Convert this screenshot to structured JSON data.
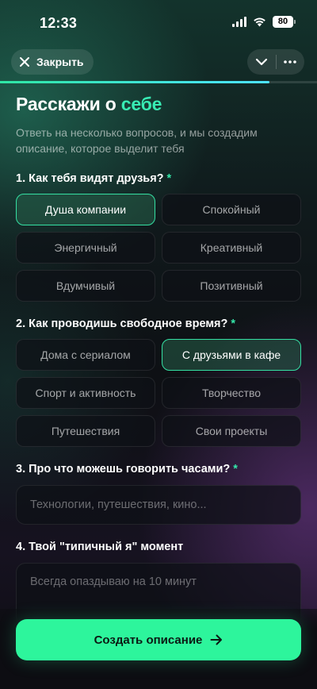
{
  "status_bar": {
    "time": "12:33",
    "battery": "80"
  },
  "nav": {
    "close_label": "Закрыть"
  },
  "progress": {
    "value": 0.85
  },
  "header": {
    "title_main": "Расскажи о ",
    "title_accent": "себе",
    "subtitle": "Ответь на несколько вопросов, и мы создадим описание, которое выделит тебя"
  },
  "questions": {
    "q1": {
      "label": "1. Как тебя видят друзья?",
      "required_mark": "*",
      "options": [
        "Душа компании",
        "Спокойный",
        "Энергичный",
        "Креативный",
        "Вдумчивый",
        "Позитивный"
      ],
      "selected": "Душа компании"
    },
    "q2": {
      "label": "2. Как проводишь свободное время?",
      "required_mark": "*",
      "options": [
        "Дома с сериалом",
        "С друзьями в кафе",
        "Спорт и активность",
        "Творчество",
        "Путешествия",
        "Свои проекты"
      ],
      "selected": "С друзьями в кафе"
    },
    "q3": {
      "label": "3. Про что можешь говорить часами?",
      "required_mark": "*",
      "placeholder": "Технологии, путешествия, кино..."
    },
    "q4": {
      "label": "4. Твой \"типичный я\" момент",
      "placeholder": "Всегда опаздываю на 10 минут"
    }
  },
  "cta": {
    "label": "Создать описание"
  },
  "colors": {
    "accent": "#38ecb4",
    "cta": "#2df59c",
    "selected_border": "#35e0a3"
  }
}
